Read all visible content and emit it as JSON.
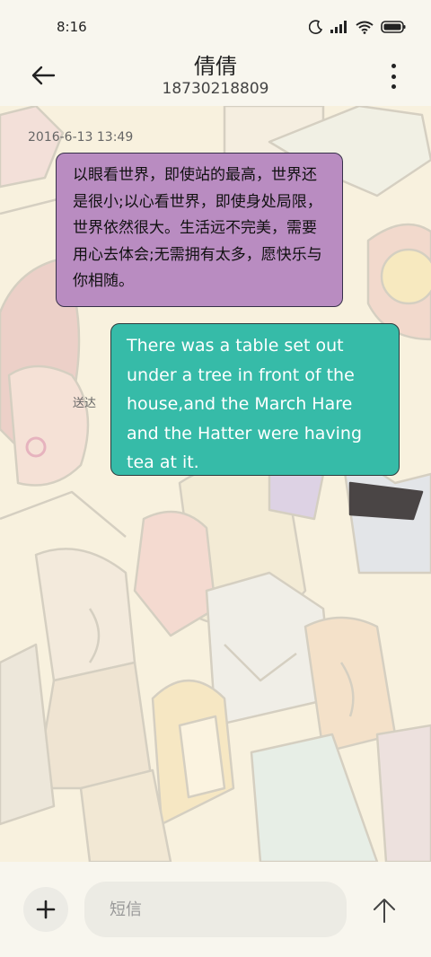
{
  "status_bar": {
    "time": "8:16"
  },
  "header": {
    "contact_name": "倩倩",
    "contact_number": "18730218809"
  },
  "conversation": {
    "timestamp": "2016-6-13 13:49",
    "incoming_message": "以眼看世界，即使站的最高，世界还是很小;以心看世界，即使身处局限，世界依然很大。生活远不完美，需要用心去体会;无需拥有太多，愿快乐与你相随。",
    "outgoing_message": "There was a table set out under a tree in front of the house,and the March Hare and the Hatter were having tea at it.",
    "delivery_status": "送达",
    "incoming_color": "#b98cc1",
    "outgoing_color": "#36bba8"
  },
  "composer": {
    "placeholder": "短信"
  },
  "icons": {
    "back": "arrow-left-icon",
    "more": "more-vertical-icon",
    "add": "plus-icon",
    "send": "arrow-up-icon",
    "moon": "moon-icon",
    "signal": "signal-icon",
    "wifi": "wifi-icon",
    "battery": "battery-icon"
  }
}
